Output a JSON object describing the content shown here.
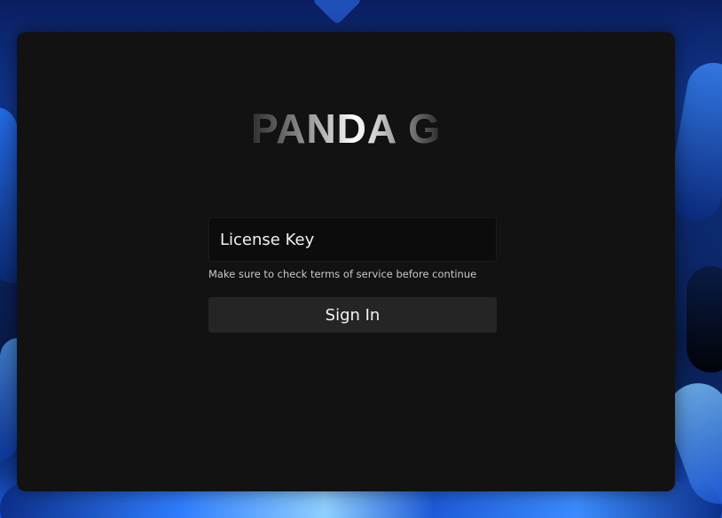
{
  "login": {
    "brand": "PANDA G",
    "license_placeholder": "License Key",
    "license_value": "",
    "hint": "Make sure to check terms of service before continue",
    "signin_label": "Sign In"
  },
  "colors": {
    "card_background": "#121212",
    "input_background": "#0c0c0c",
    "button_background": "#252525",
    "text_primary": "#ffffff",
    "text_muted": "#c9c9c9"
  }
}
